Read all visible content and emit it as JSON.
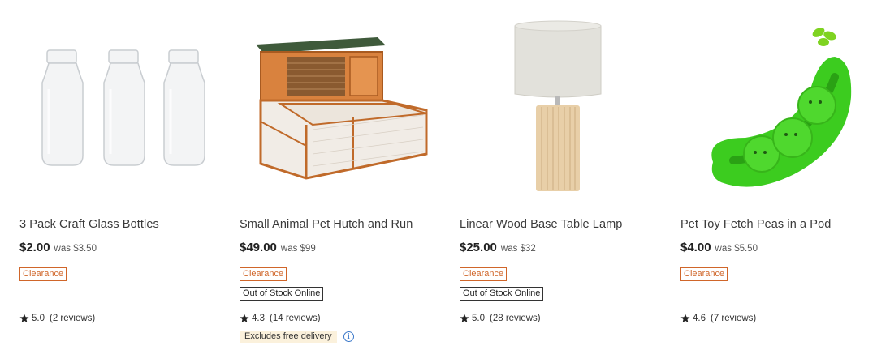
{
  "products": [
    {
      "title": "3 Pack Craft Glass Bottles",
      "price": "$2.00",
      "was": "was $3.50",
      "badges": {
        "clearance": "Clearance",
        "out_of_stock": ""
      },
      "rating": "5.0",
      "reviews": "(2 reviews)",
      "delivery_note": "",
      "image_icon": "glass-bottles-image"
    },
    {
      "title": "Small Animal Pet Hutch and Run",
      "price": "$49.00",
      "was": "was $99",
      "badges": {
        "clearance": "Clearance",
        "out_of_stock": "Out of Stock Online"
      },
      "rating": "4.3",
      "reviews": "(14 reviews)",
      "delivery_note": "Excludes free delivery",
      "image_icon": "pet-hutch-image"
    },
    {
      "title": "Linear Wood Base Table Lamp",
      "price": "$25.00",
      "was": "was $32",
      "badges": {
        "clearance": "Clearance",
        "out_of_stock": "Out of Stock Online"
      },
      "rating": "5.0",
      "reviews": "(28 reviews)",
      "delivery_note": "",
      "image_icon": "table-lamp-image"
    },
    {
      "title": "Pet Toy Fetch Peas in a Pod",
      "price": "$4.00",
      "was": "was $5.50",
      "badges": {
        "clearance": "Clearance",
        "out_of_stock": ""
      },
      "rating": "4.6",
      "reviews": "(7 reviews)",
      "delivery_note": "",
      "image_icon": "peas-pod-toy-image"
    }
  ],
  "colors": {
    "clearance": "#d0662a",
    "info_blue": "#3b78c9",
    "delivery_bg": "#fbf1dc"
  }
}
